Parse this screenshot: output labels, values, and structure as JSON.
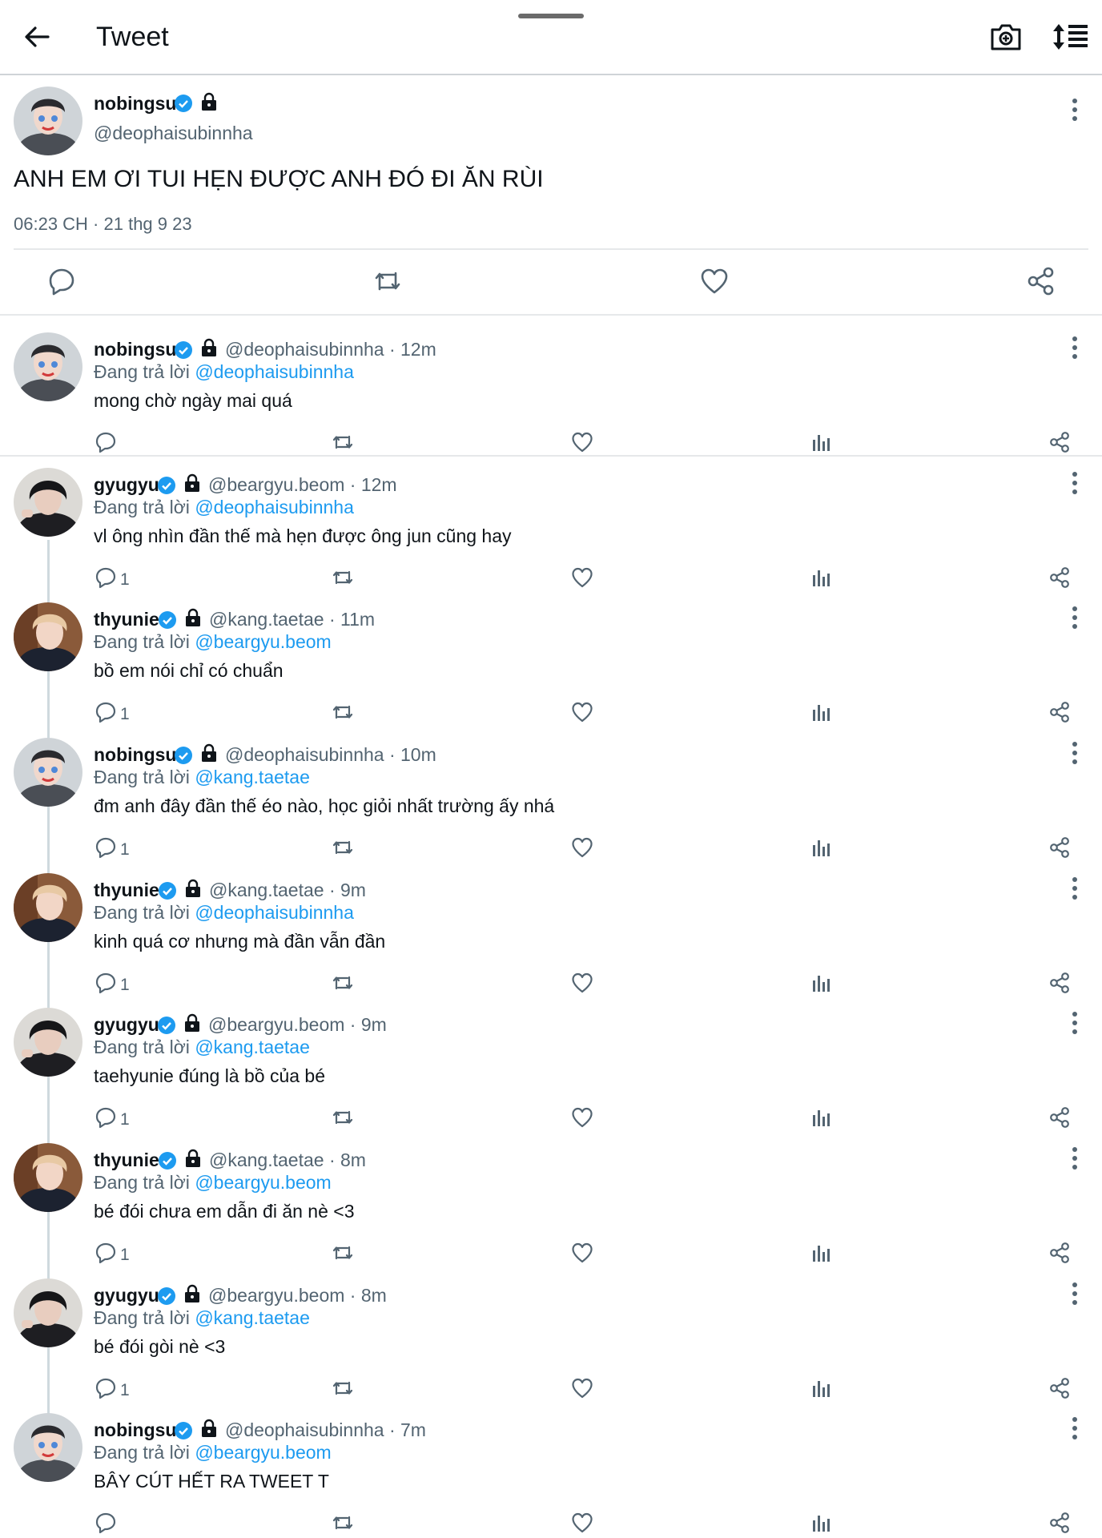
{
  "topbar": {
    "title": "Tweet"
  },
  "main_tweet": {
    "name": "nobingsu",
    "handle": "@deophaisubinnha",
    "text": "ANH EM ƠI TUI HẸN ĐƯỢC ANH ĐÓ ĐI ĂN RÙI",
    "time": "06:23 CH · 21 thg 9 23"
  },
  "replying_prefix": "Đang trả lời",
  "replies": [
    {
      "name": "nobingsu",
      "meta": "@deophaisubinnha · 12m",
      "reply_to": "@deophaisubinnha",
      "text": "mong chờ ngày mai quá",
      "reply_count": ""
    },
    {
      "name": "gyugyu",
      "meta": "@beargyu.beom · 12m",
      "reply_to": "@deophaisubinnha",
      "text": "vl ông nhìn đần thế mà hẹn được ông jun cũng hay",
      "reply_count": "1"
    },
    {
      "name": "thyunie",
      "meta": "@kang.taetae · 11m",
      "reply_to": "@beargyu.beom",
      "text": "bồ em nói chỉ có chuẩn",
      "reply_count": "1"
    },
    {
      "name": "nobingsu",
      "meta": "@deophaisubinnha · 10m",
      "reply_to": "@kang.taetae",
      "text": "đm anh đây đần thế éo nào, học giỏi nhất trường ấy nhá",
      "reply_count": "1"
    },
    {
      "name": "thyunie",
      "meta": "@kang.taetae · 9m",
      "reply_to": "@deophaisubinnha",
      "text": "kinh quá cơ nhưng mà đần vẫn đần",
      "reply_count": "1"
    },
    {
      "name": "gyugyu",
      "meta": "@beargyu.beom · 9m",
      "reply_to": "@kang.taetae",
      "text": "taehyunie đúng là bồ của bé",
      "reply_count": "1"
    },
    {
      "name": "thyunie",
      "meta": "@kang.taetae · 8m",
      "reply_to": "@beargyu.beom",
      "text": "bé đói chưa em dẫn đi ăn nè <3",
      "reply_count": "1"
    },
    {
      "name": "gyugyu",
      "meta": "@beargyu.beom · 8m",
      "reply_to": "@kang.taetae",
      "text": "bé đói gòi nè <3",
      "reply_count": "1"
    },
    {
      "name": "nobingsu",
      "meta": "@deophaisubinnha · 7m",
      "reply_to": "@beargyu.beom",
      "text": "BÂY CÚT HẾT RA TWEET T",
      "reply_count": ""
    }
  ],
  "colors": {
    "accent": "#1d9bf0",
    "secondary_text": "#536471",
    "divider": "#e6e8ea"
  }
}
